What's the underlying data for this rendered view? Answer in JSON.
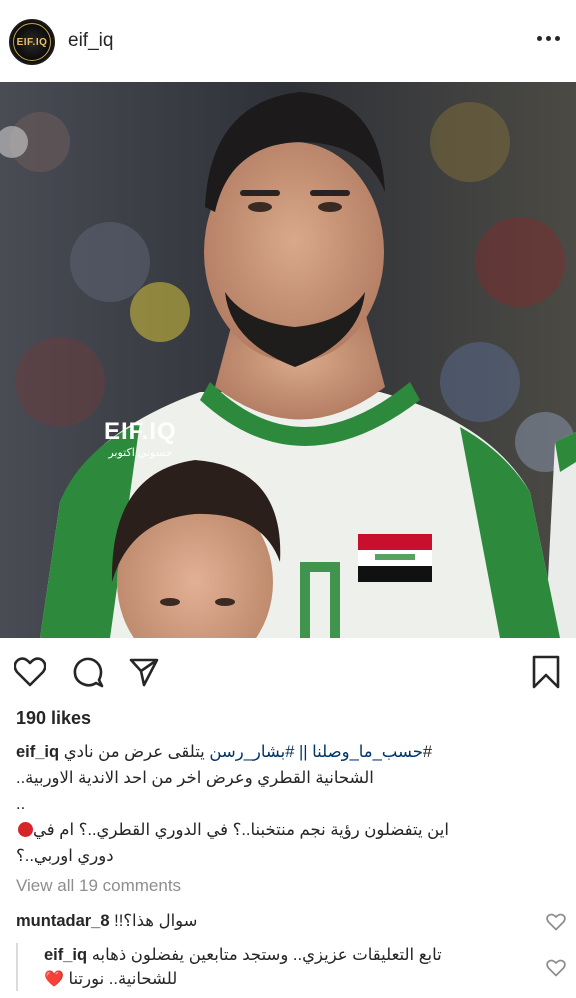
{
  "post": {
    "username": "eif_iq",
    "avatar_text": "EIF.IQ",
    "watermark_logo": "EIF.IQ",
    "watermark_sub": "حسوني اكتوبر",
    "likes": "190 likes"
  },
  "caption": {
    "user": "eif_iq",
    "line1_tags": "حسب_ما_وصلنا || #بشار_رسن",
    "line1_text": "يتلقى عرض من نادي#",
    "line2": "..الشحانية القطري وعرض اخر من احد الاندية الاوربية",
    "line3": "..",
    "line4": "اين يتفضلون رؤية نجم منتخبنا..؟ في الدوري القطري..؟ ام في",
    "line5": "دوري اوربي..؟"
  },
  "view_all_comments": "View all 19 comments",
  "comments": [
    {
      "user": "muntadar_8",
      "text": "!!سوال هذا؟"
    },
    {
      "user": "eif_iq",
      "line1": "تابع التعليقات عزيزي.. وستجد متابعين يفضلون ذهابه",
      "line2": "للشحانية.. نورتنا",
      "emoji": "❤️"
    }
  ],
  "icons": {
    "more": "more-options-icon",
    "like": "heart-icon",
    "comment": "comment-icon",
    "share": "share-icon",
    "save": "bookmark-icon"
  }
}
